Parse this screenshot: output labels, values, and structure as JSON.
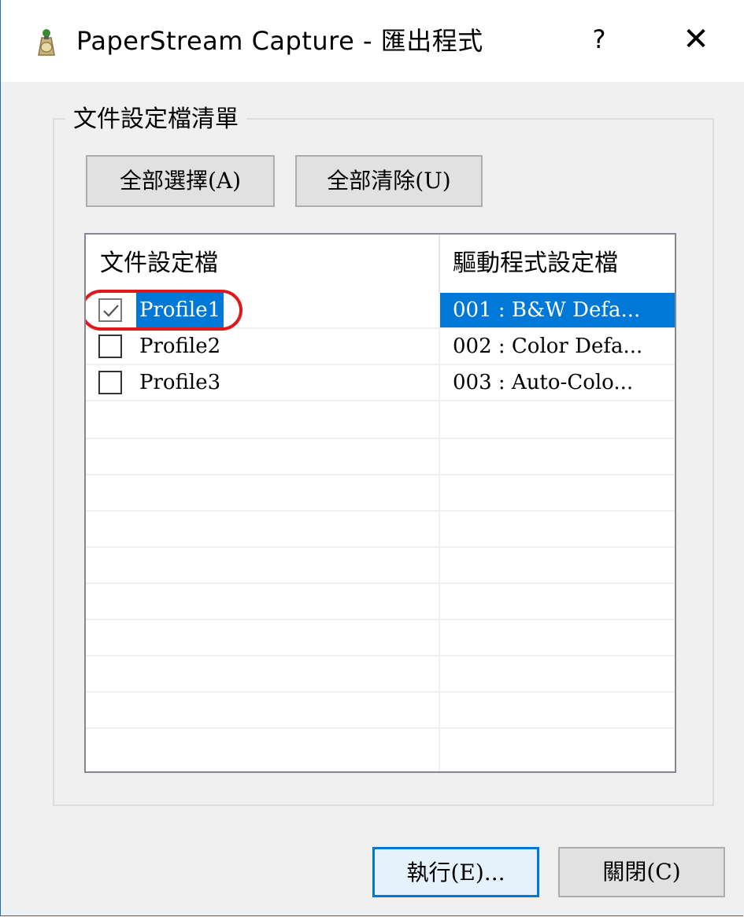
{
  "window": {
    "title": "PaperStream Capture - 匯出程式",
    "help_label": "?",
    "close_label": "✕"
  },
  "group": {
    "title": "文件設定檔清單",
    "select_all_label": "全部選擇(A)",
    "clear_all_label": "全部清除(U)"
  },
  "list": {
    "columns": [
      "文件設定檔",
      "驅動程式設定檔"
    ],
    "rows": [
      {
        "checked": true,
        "selected": true,
        "profile": "Profile1",
        "driver": "001 : B&W Defa..."
      },
      {
        "checked": false,
        "selected": false,
        "profile": "Profile2",
        "driver": "002 : Color Defa..."
      },
      {
        "checked": false,
        "selected": false,
        "profile": "Profile3",
        "driver": "003 : Auto-Colo..."
      }
    ]
  },
  "footer": {
    "run_label": "執行(E)...",
    "close_label": "關閉(C)"
  },
  "colors": {
    "selection": "#0078d7",
    "highlight": "#e0181c"
  }
}
